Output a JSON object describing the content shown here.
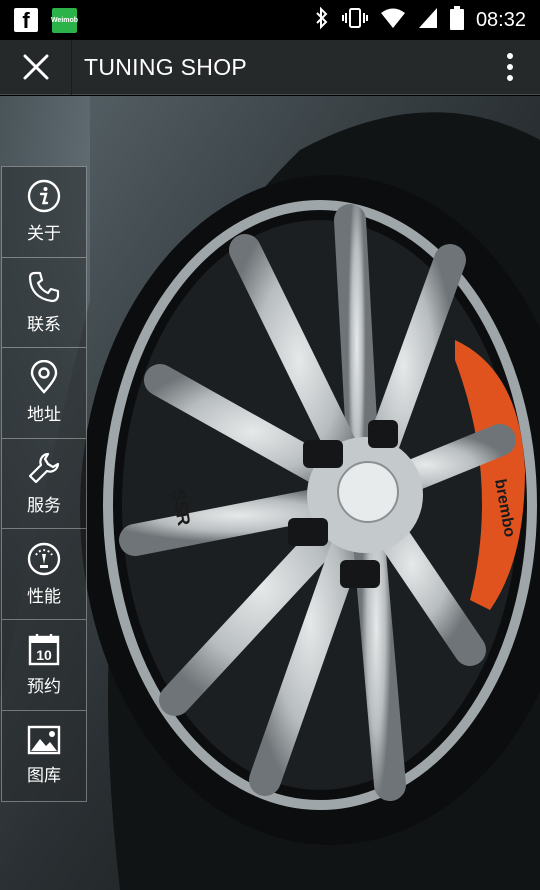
{
  "status_bar": {
    "left_icons": [
      "facebook-icon",
      "weimob-icon"
    ],
    "weimob_label": "Weimob",
    "right_icons": [
      "bluetooth-icon",
      "vibrate-icon",
      "wifi-icon",
      "signal-icon",
      "battery-icon"
    ],
    "time": "08:32"
  },
  "header": {
    "title": "TUNING SHOP",
    "left_icon": "close-icon",
    "right_icon": "more-vert-icon"
  },
  "hero": {
    "image": "car-wheel-photo",
    "wheel_spoke_text": "SSR",
    "caliper_text": "brembo"
  },
  "sidemenu": {
    "items": [
      {
        "label": "关于",
        "icon": "info-icon"
      },
      {
        "label": "联系",
        "icon": "phone-icon"
      },
      {
        "label": "地址",
        "icon": "location-pin-icon"
      },
      {
        "label": "服务",
        "icon": "wrench-icon"
      },
      {
        "label": "性能",
        "icon": "gauge-icon"
      },
      {
        "label": "预约",
        "icon": "calendar-icon"
      },
      {
        "label": "图库",
        "icon": "image-icon"
      }
    ]
  },
  "colors": {
    "header_bg": "#26292a",
    "status_bg": "#000000",
    "weimob_green": "#2bb34a",
    "caliper_orange": "#e0531f"
  }
}
